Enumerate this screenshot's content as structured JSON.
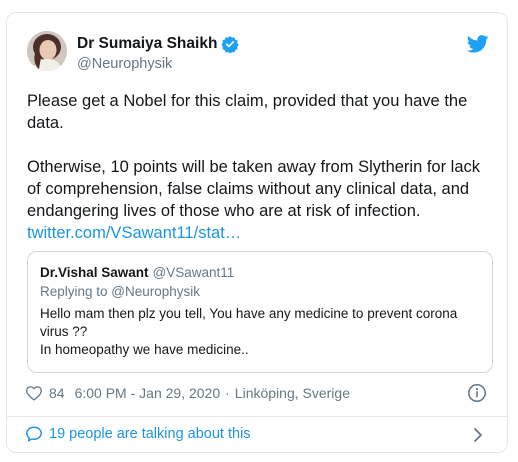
{
  "author": {
    "display_name": "Dr Sumaiya Shaikh",
    "handle": "@Neurophysik"
  },
  "tweet": {
    "paragraph1": "Please get a Nobel for this claim, provided that you have the data.",
    "paragraph2": "Otherwise, 10 points will be taken away from Slytherin for lack of comprehension, false claims without any clinical data, and endangering lives of those who are at risk of infection.",
    "link": "twitter.com/VSawant11/stat…"
  },
  "quoted": {
    "name": "Dr.Vishal Sawant",
    "handle": "@VSawant11",
    "replying": "Replying to @Neurophysik",
    "text_line1": "Hello mam then plz you tell, You have any medicine to prevent corona virus ??",
    "text_line2": "In homeopathy we have medicine.."
  },
  "meta": {
    "likes": "84",
    "time": "6:00 PM - Jan 29, 2020",
    "separator": "·",
    "location": "Linköping, Sverige"
  },
  "footer": {
    "talking": "19 people are talking about this"
  },
  "icons": {
    "verified": "verified-badge-icon",
    "bird": "twitter-bird-icon",
    "heart": "heart-icon",
    "info": "info-icon",
    "bubble": "speech-bubble-icon",
    "chevron": "chevron-right-icon"
  },
  "colors": {
    "link_blue": "#1b95e0",
    "text": "#14171a",
    "muted": "#657786",
    "border": "#e1e8ed"
  }
}
